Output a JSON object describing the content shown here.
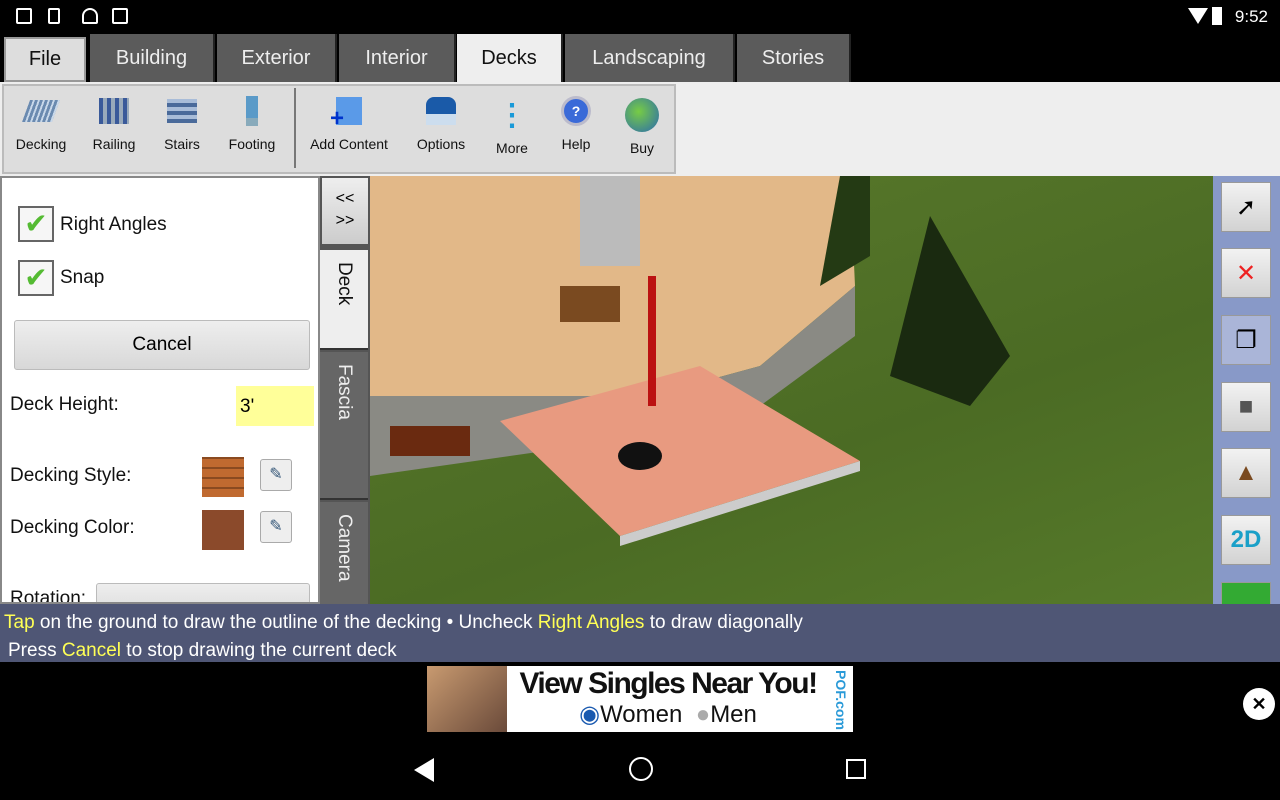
{
  "status": {
    "time": "9:52"
  },
  "tabs": [
    {
      "label": "File"
    },
    {
      "label": "Building"
    },
    {
      "label": "Exterior"
    },
    {
      "label": "Interior"
    },
    {
      "label": "Decks",
      "active": true
    },
    {
      "label": "Landscaping"
    },
    {
      "label": "Stories"
    }
  ],
  "toolbar": [
    {
      "label": "Decking",
      "icon": "decking-icon"
    },
    {
      "label": "Railing",
      "icon": "railing-icon"
    },
    {
      "label": "Stairs",
      "icon": "stairs-icon"
    },
    {
      "label": "Footing",
      "icon": "footing-icon"
    },
    {
      "label": "Add Content",
      "icon": "add-content-icon"
    },
    {
      "label": "Options",
      "icon": "options-icon"
    },
    {
      "label": "More",
      "icon": "more-icon"
    },
    {
      "label": "Help",
      "icon": "help-icon"
    },
    {
      "label": "Buy",
      "icon": "buy-icon"
    }
  ],
  "panel": {
    "right_angles": "Right Angles",
    "right_angles_checked": true,
    "snap": "Snap",
    "snap_checked": true,
    "cancel": "Cancel",
    "deck_height_label": "Deck Height:",
    "deck_height_value": "3'",
    "decking_style_label": "Decking Style:",
    "decking_color_label": "Decking Color:",
    "decking_color": "#8b4a2b",
    "rotation_label": "Rotation:"
  },
  "side_tabs": {
    "toggle": "<<\n>>",
    "deck": "Deck",
    "fascia": "Fascia",
    "camera": "Camera"
  },
  "right_tools": [
    {
      "icon": "pointer-icon"
    },
    {
      "icon": "delete-icon"
    },
    {
      "icon": "copy-icon"
    },
    {
      "icon": "box-icon"
    },
    {
      "icon": "roof-icon"
    },
    {
      "icon": "2d-icon",
      "label": "2D"
    },
    {
      "icon": "terrain-icon"
    }
  ],
  "hint": {
    "l1_a": "Tap",
    "l1_b": " on the ground to draw the outline of the decking  •  Uncheck ",
    "l1_c": "Right Angles",
    "l1_d": " to draw diagonally",
    "l2_a": "Press ",
    "l2_b": "Cancel",
    "l2_c": " to stop drawing the current deck"
  },
  "ad": {
    "headline": "View Singles Near You!",
    "opt1": "Women",
    "opt2": "Men",
    "brand": "POF.com"
  }
}
